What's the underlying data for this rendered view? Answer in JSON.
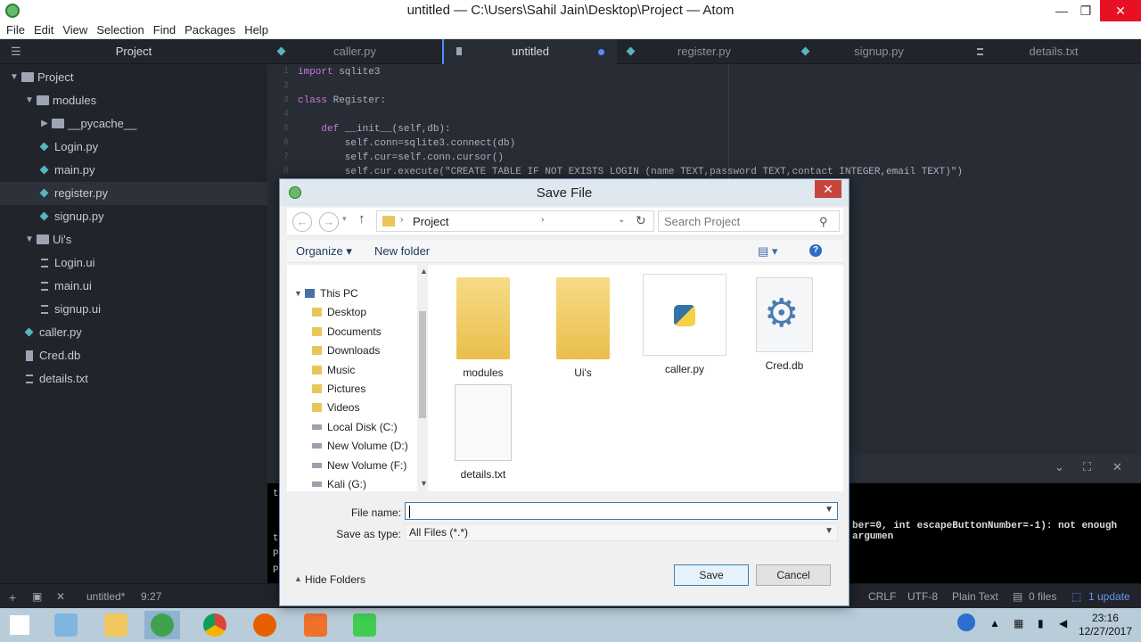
{
  "window": {
    "title": "untitled — C:\\Users\\Sahil Jain\\Desktop\\Project — Atom",
    "min": "—",
    "max": "❐",
    "close": "✕"
  },
  "menu": [
    "File",
    "Edit",
    "View",
    "Selection",
    "Find",
    "Packages",
    "Help"
  ],
  "tree": {
    "header": "Project",
    "items": [
      {
        "label": "Project",
        "kind": "folder",
        "open": true,
        "depth": 0
      },
      {
        "label": "modules",
        "kind": "folder",
        "open": true,
        "depth": 1
      },
      {
        "label": "__pycache__",
        "kind": "folder",
        "open": false,
        "depth": 2
      },
      {
        "label": "Login.py",
        "kind": "py",
        "depth": 2
      },
      {
        "label": "main.py",
        "kind": "py",
        "depth": 2
      },
      {
        "label": "register.py",
        "kind": "py",
        "depth": 2,
        "selected": true
      },
      {
        "label": "signup.py",
        "kind": "py",
        "depth": 2
      },
      {
        "label": "Ui's",
        "kind": "folder",
        "open": true,
        "depth": 1
      },
      {
        "label": "Login.ui",
        "kind": "txt",
        "depth": 2
      },
      {
        "label": "main.ui",
        "kind": "txt",
        "depth": 2
      },
      {
        "label": "signup.ui",
        "kind": "txt",
        "depth": 2
      },
      {
        "label": "caller.py",
        "kind": "py",
        "depth": 1
      },
      {
        "label": "Cred.db",
        "kind": "db",
        "depth": 1
      },
      {
        "label": "details.txt",
        "kind": "txt",
        "depth": 1
      }
    ]
  },
  "tabs": [
    {
      "label": "caller.py",
      "active": false
    },
    {
      "label": "untitled",
      "active": true,
      "modified": true
    },
    {
      "label": "register.py",
      "active": false
    },
    {
      "label": "signup.py",
      "active": false
    },
    {
      "label": "details.txt",
      "active": false
    }
  ],
  "code": [
    {
      "n": "1",
      "text": "import sqlite3"
    },
    {
      "n": "2",
      "text": ""
    },
    {
      "n": "3",
      "text": "class Register:"
    },
    {
      "n": "4",
      "text": ""
    },
    {
      "n": "5",
      "text": "    def __init__(self,db):"
    },
    {
      "n": "6",
      "text": "        self.conn=sqlite3.connect(db)"
    },
    {
      "n": "7",
      "text": "        self.cur=self.conn.cursor()"
    },
    {
      "n": "8",
      "text": "        self.cur.execute(\"CREATE TABLE IF NOT EXISTS LOGIN (name TEXT,password TEXT,contact INTEGER,email TEXT)\")"
    }
  ],
  "console": {
    "prompt_lines": [
      "t",
      "t",
      "P",
      "P"
    ],
    "error_text": "ber=0, int escapeButtonNumber=-1): not enough argumen"
  },
  "status": {
    "file": "untitled*",
    "cursor": "9:27",
    "line_ending": "CRLF",
    "encoding": "UTF-8",
    "grammar": "Plain Text",
    "files": "0 files",
    "updates": "1 update"
  },
  "dialog": {
    "title": "Save File",
    "breadcrumb": "Project",
    "search_placeholder": "Search Project",
    "organize": "Organize ▾",
    "new_folder": "New folder",
    "nav": [
      {
        "label": "This PC",
        "icon": "pc"
      },
      {
        "label": "Desktop",
        "icon": "folder"
      },
      {
        "label": "Documents",
        "icon": "folder"
      },
      {
        "label": "Downloads",
        "icon": "folder"
      },
      {
        "label": "Music",
        "icon": "folder"
      },
      {
        "label": "Pictures",
        "icon": "folder"
      },
      {
        "label": "Videos",
        "icon": "folder"
      },
      {
        "label": "Local Disk (C:)",
        "icon": "drive"
      },
      {
        "label": "New Volume (D:)",
        "icon": "drive"
      },
      {
        "label": "New Volume (F:)",
        "icon": "drive"
      },
      {
        "label": "Kali (G:)",
        "icon": "drive"
      }
    ],
    "items": [
      {
        "label": "modules",
        "kind": "folder"
      },
      {
        "label": "Ui's",
        "kind": "folder"
      },
      {
        "label": "caller.py",
        "kind": "python-file"
      },
      {
        "label": "Cred.db",
        "kind": "db-file"
      },
      {
        "label": "details.txt",
        "kind": "text-file"
      }
    ],
    "file_name_label": "File name:",
    "file_name_value": "",
    "save_type_label": "Save as type:",
    "save_type_value": "All Files (*.*)",
    "hide_folders": "Hide Folders",
    "save": "Save",
    "cancel": "Cancel"
  },
  "clock": {
    "time": "23:16",
    "date": "12/27/2017"
  }
}
